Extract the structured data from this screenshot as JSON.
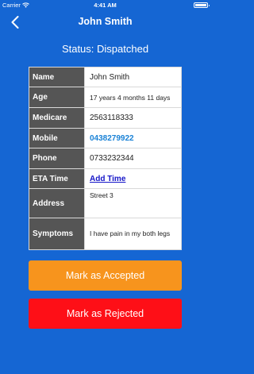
{
  "status_bar": {
    "carrier": "Carrier",
    "time": "4:41 AM"
  },
  "nav": {
    "title": "John Smith",
    "back_icon": "chevron-left-icon"
  },
  "status": {
    "text": "Status: Dispatched"
  },
  "details": {
    "name_label": "Name",
    "name_value": "John Smith",
    "age_label": "Age",
    "age_value": "17 years 4 months 11 days",
    "medicare_label": "Medicare",
    "medicare_value": "2563118333",
    "mobile_label": "Mobile",
    "mobile_value": "0438279922",
    "phone_label": "Phone",
    "phone_value": "0733232344",
    "eta_label": "ETA Time",
    "eta_action": "Add Time",
    "address_label": "Address",
    "address_value": "Street 3",
    "symptoms_label": "Symptoms",
    "symptoms_value": "I have pain in my both legs"
  },
  "actions": {
    "accept_label": "Mark as Accepted",
    "reject_label": "Mark as Rejected"
  },
  "colors": {
    "background": "#1566d3",
    "label_bg": "#555555",
    "accept": "#f7941d",
    "reject": "#fe0f17",
    "link": "#1a82d6"
  }
}
